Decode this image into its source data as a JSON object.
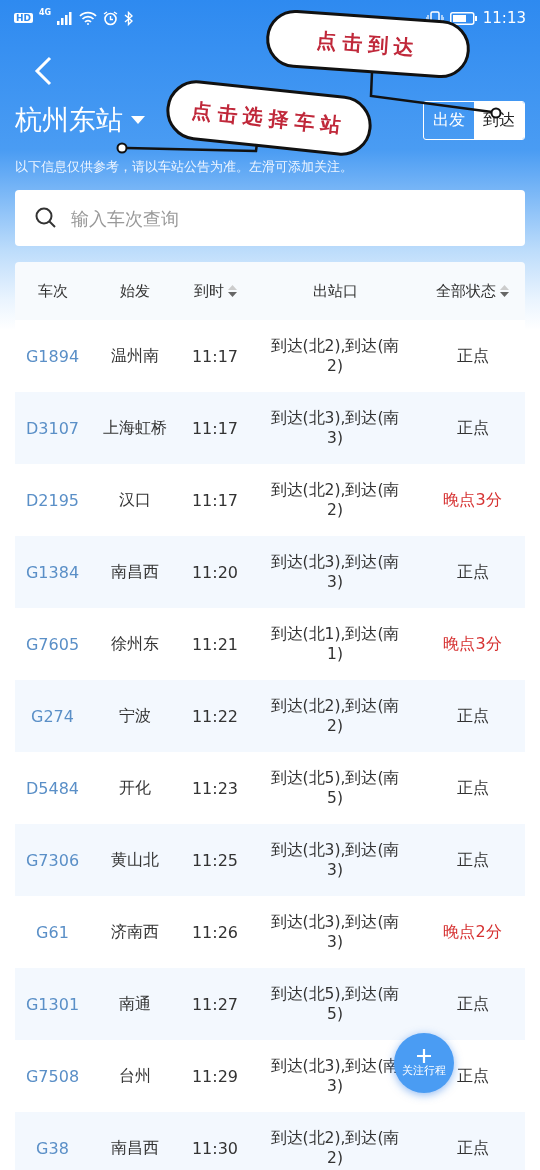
{
  "status_bar": {
    "hd": "HD",
    "network": "4G",
    "time": "11:13"
  },
  "station": "杭州东站",
  "direction_tabs": [
    {
      "label": "出发",
      "selected": false
    },
    {
      "label": "到达",
      "selected": true
    }
  ],
  "notice": "以下信息仅供参考，请以车站公告为准。左滑可添加关注。",
  "search": {
    "placeholder": "输入车次查询"
  },
  "table": {
    "columns": [
      {
        "label": "车次",
        "sortable": false
      },
      {
        "label": "始发",
        "sortable": false
      },
      {
        "label": "到时",
        "sortable": true
      },
      {
        "label": "出站口",
        "sortable": false
      },
      {
        "label": "全部状态",
        "sortable": true
      }
    ],
    "rows": [
      {
        "train": "G1894",
        "origin": "温州南",
        "time": "11:17",
        "exit": "到达(北2),到达(南2)",
        "status": "正点",
        "delayed": false
      },
      {
        "train": "D3107",
        "origin": "上海虹桥",
        "time": "11:17",
        "exit": "到达(北3),到达(南3)",
        "status": "正点",
        "delayed": false
      },
      {
        "train": "D2195",
        "origin": "汉口",
        "time": "11:17",
        "exit": "到达(北2),到达(南2)",
        "status": "晚点3分",
        "delayed": true
      },
      {
        "train": "G1384",
        "origin": "南昌西",
        "time": "11:20",
        "exit": "到达(北3),到达(南3)",
        "status": "正点",
        "delayed": false
      },
      {
        "train": "G7605",
        "origin": "徐州东",
        "time": "11:21",
        "exit": "到达(北1),到达(南1)",
        "status": "晚点3分",
        "delayed": true
      },
      {
        "train": "G274",
        "origin": "宁波",
        "time": "11:22",
        "exit": "到达(北2),到达(南2)",
        "status": "正点",
        "delayed": false
      },
      {
        "train": "D5484",
        "origin": "开化",
        "time": "11:23",
        "exit": "到达(北5),到达(南5)",
        "status": "正点",
        "delayed": false
      },
      {
        "train": "G7306",
        "origin": "黄山北",
        "time": "11:25",
        "exit": "到达(北3),到达(南3)",
        "status": "正点",
        "delayed": false
      },
      {
        "train": "G61",
        "origin": "济南西",
        "time": "11:26",
        "exit": "到达(北3),到达(南3)",
        "status": "晚点2分",
        "delayed": true
      },
      {
        "train": "G1301",
        "origin": "南通",
        "time": "11:27",
        "exit": "到达(北5),到达(南5)",
        "status": "正点",
        "delayed": false
      },
      {
        "train": "G7508",
        "origin": "台州",
        "time": "11:29",
        "exit": "到达(北3),到达(南3)",
        "status": "正点",
        "delayed": false
      },
      {
        "train": "G38",
        "origin": "南昌西",
        "time": "11:30",
        "exit": "到达(北2),到达(南2)",
        "status": "正点",
        "delayed": false
      }
    ]
  },
  "fab": {
    "label": "关注行程"
  },
  "annotations": [
    {
      "text": "点击到达"
    },
    {
      "text": "点击选择车站"
    }
  ]
}
